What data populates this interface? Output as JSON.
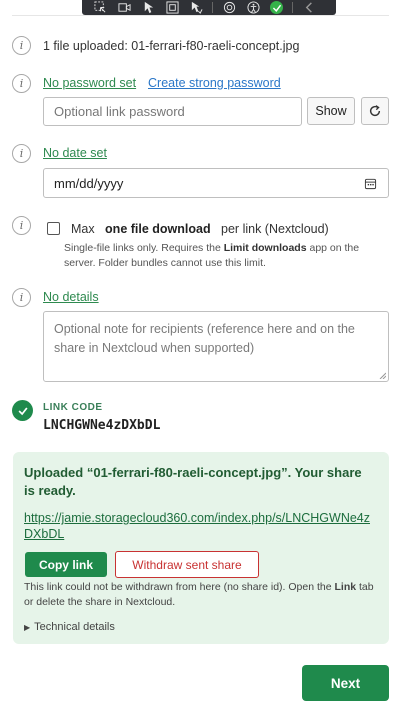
{
  "toolbar": {
    "icons": [
      "select-icon",
      "video-icon",
      "pointer-icon",
      "frame-icon",
      "pointer-check-icon",
      "stamp-icon",
      "accessibility-icon",
      "checkmark-icon",
      "collapse-icon"
    ]
  },
  "upload": {
    "summary": "1 file uploaded: 01-ferrari-f80-raeli-concept.jpg"
  },
  "password": {
    "status_link": "No password set",
    "create_link": "Create strong password",
    "placeholder": "Optional link password",
    "show_label": "Show"
  },
  "expiry": {
    "status_link": "No date set",
    "date_placeholder": "mm/dd/yyyy"
  },
  "download_limit": {
    "prefix": "Max",
    "bold": "one file download",
    "suffix": "per link (Nextcloud)",
    "help_line1_pre": "Single-file links only. Requires the ",
    "help_line1_bold": "Limit downloads",
    "help_line1_post": " app on the",
    "help_line2": "server. Folder bundles cannot use this limit."
  },
  "details": {
    "status_link": "No details",
    "placeholder": "Optional note for recipients (reference here and on the share in Nextcloud when supported)"
  },
  "link_code": {
    "label": "LINK CODE",
    "value": "LNCHGWNe4zDXbDL"
  },
  "success": {
    "title": "Uploaded “01-ferrari-f80-raeli-concept.jpg”. Your share is ready.",
    "url": "https://jamie.storagecloud360.com/index.php/s/LNCHGWNe4zDXbDL",
    "copy_label": "Copy link",
    "withdraw_label": "Withdraw sent share",
    "note_pre": "This link could not be withdrawn from here (no share id). Open the ",
    "note_bold": "Link",
    "note_post": " tab or delete the share in Nextcloud.",
    "technical_label": "Technical details"
  },
  "footer": {
    "next_label": "Next"
  },
  "colors": {
    "accent_green": "#1f8a4c",
    "danger_red": "#c83232",
    "link_blue": "#2b77c8",
    "success_bg": "#e6f4e9"
  }
}
